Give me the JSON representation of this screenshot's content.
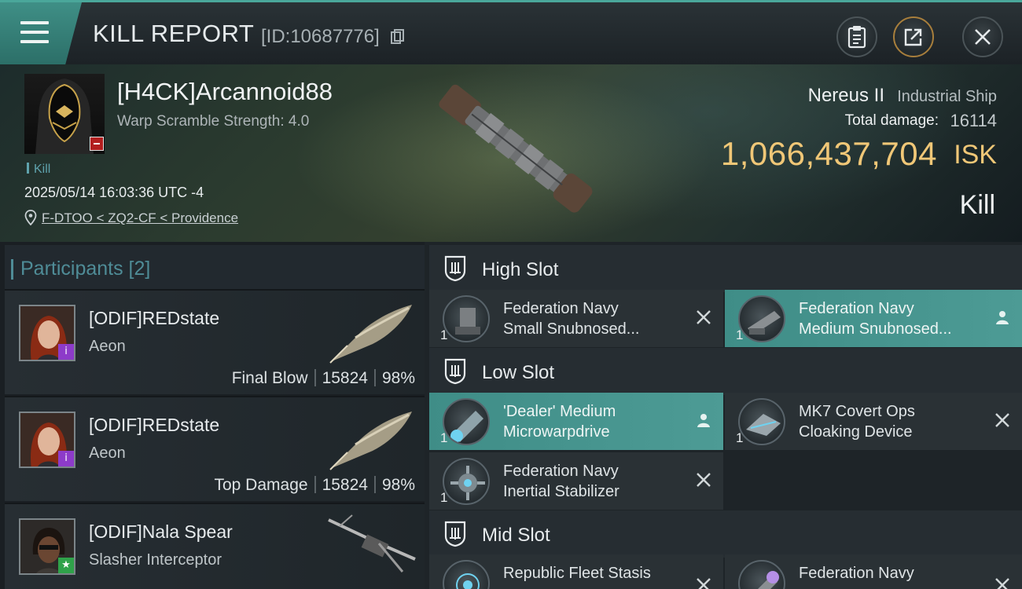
{
  "header": {
    "title": "KILL REPORT",
    "report_id": "[ID:10687776]"
  },
  "victim": {
    "name": "[H4CK]Arcannoid88",
    "warp_scramble": "Warp Scramble Strength: 4.0",
    "kill_tag": "Kill",
    "datetime": "2025/05/14 16:03:36 UTC -4",
    "location": "F-DTOO < ZQ2-CF < Providence"
  },
  "ship": {
    "name": "Nereus II",
    "class": "Industrial Ship",
    "total_damage_label": "Total damage:",
    "total_damage": "16114",
    "isk_value": "1,066,437,704",
    "isk_unit": "ISK",
    "result": "Kill"
  },
  "participants": {
    "label": "Participants [2]",
    "rows": [
      {
        "name": "[ODIF]REDstate",
        "ship": "Aeon",
        "role": "Final Blow",
        "damage": "15824",
        "percent": "98%",
        "badge": "i"
      },
      {
        "name": "[ODIF]REDstate",
        "ship": "Aeon",
        "role": "Top Damage",
        "damage": "15824",
        "percent": "98%",
        "badge": "i"
      },
      {
        "name": "[ODIF]Nala Spear",
        "ship": "Slasher Interceptor",
        "badge": "★"
      }
    ]
  },
  "fitting": {
    "high": {
      "label": "High Slot",
      "modules": [
        {
          "qty": "1",
          "line1": "Federation Navy",
          "line2": "Small Snubnosed...",
          "icon": "close-icon"
        },
        {
          "qty": "1",
          "line1": "Federation Navy",
          "line2": "Medium Snubnosed...",
          "icon": "person-icon"
        }
      ]
    },
    "low": {
      "label": "Low Slot",
      "modules": [
        {
          "qty": "1",
          "line1": "'Dealer' Medium",
          "line2": "Microwarpdrive",
          "icon": "person-icon"
        },
        {
          "qty": "1",
          "line1": "MK7 Covert Ops",
          "line2": "Cloaking Device",
          "icon": "close-icon"
        },
        {
          "qty": "1",
          "line1": "Federation Navy",
          "line2": "Inertial Stabilizer",
          "icon": "close-icon"
        }
      ]
    },
    "mid": {
      "label": "Mid Slot",
      "modules": [
        {
          "line1": "Republic Fleet Stasis",
          "icon": "close-icon"
        },
        {
          "line1": "Federation Navy",
          "icon": "close-icon"
        }
      ]
    }
  },
  "colors": {
    "accent_teal": "#4aa79a",
    "isk_gold": "#f0c777",
    "active_module": "#4d9b95",
    "loss_red": "#b31f1f"
  }
}
